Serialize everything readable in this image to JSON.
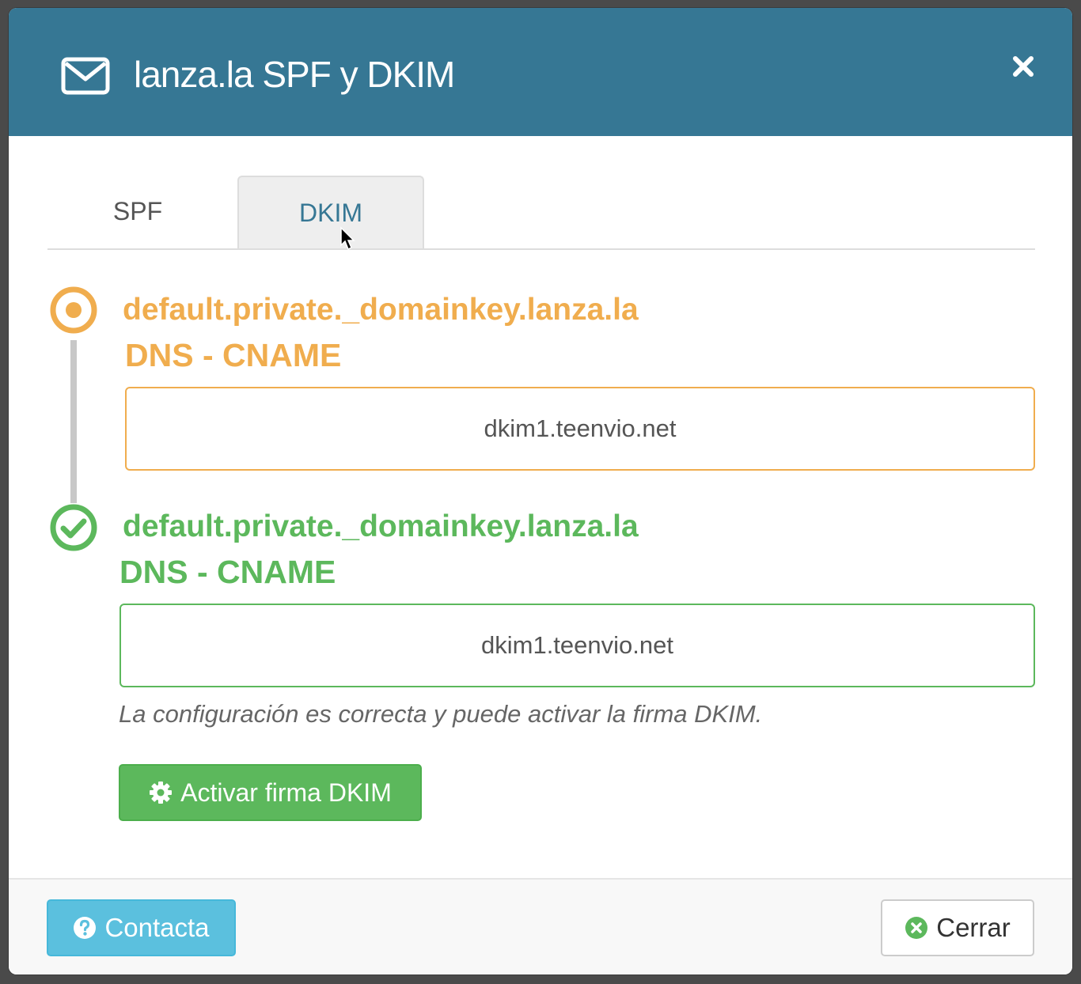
{
  "modal": {
    "title": "lanza.la SPF y DKIM",
    "header_icon": "envelope-icon",
    "close_icon": "close-icon"
  },
  "tabs": [
    {
      "label": "SPF",
      "active": false
    },
    {
      "label": "DKIM",
      "active": true
    }
  ],
  "records": [
    {
      "status": "pending",
      "status_icon": "dot-circle-icon",
      "name": "default.private._domainkey.lanza.la",
      "type": "DNS - CNAME",
      "value": "dkim1.teenvio.net"
    },
    {
      "status": "ok",
      "status_icon": "check-circle-icon",
      "name": "default.private._domainkey.lanza.la",
      "type": "DNS - CNAME",
      "value": "dkim1.teenvio.net"
    }
  ],
  "help_text": "La configuración es correcta y puede activar la firma DKIM.",
  "activate_button": {
    "label": "Activar firma DKIM",
    "icon": "gear-icon"
  },
  "footer": {
    "contact_button": {
      "label": "Contacta",
      "icon": "question-circle-icon"
    },
    "close_button": {
      "label": "Cerrar",
      "icon": "times-circle-icon"
    }
  },
  "colors": {
    "header": "#367794",
    "pending": "#f0ad4e",
    "success": "#5cb85c",
    "info": "#5bc0de"
  }
}
